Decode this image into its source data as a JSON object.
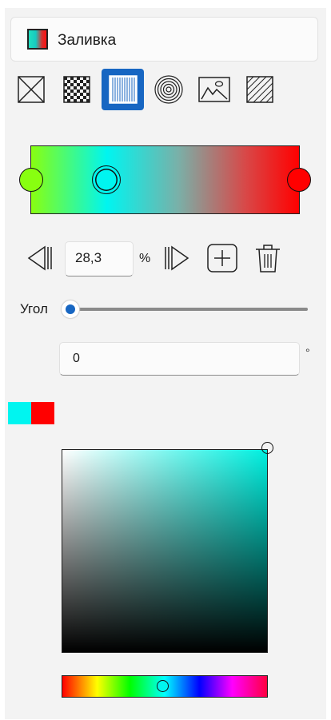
{
  "fill": {
    "title": "Заливка",
    "types": [
      {
        "icon": "no-fill-icon",
        "selected": false
      },
      {
        "icon": "pattern-fill-icon",
        "selected": false
      },
      {
        "icon": "linear-gradient-fill-icon",
        "selected": true
      },
      {
        "icon": "radial-gradient-fill-icon",
        "selected": false
      },
      {
        "icon": "image-fill-icon",
        "selected": false
      },
      {
        "icon": "hatch-fill-icon",
        "selected": false
      }
    ]
  },
  "gradient": {
    "stops": [
      {
        "position": 0,
        "color": "#88ff10"
      },
      {
        "position": 28.3,
        "color": "#00f5f0",
        "selected": true
      },
      {
        "position": 100,
        "color": "#ff0000"
      }
    ],
    "stop_position_value": "28,3",
    "stop_position_unit": "%"
  },
  "angle": {
    "label": "Угол",
    "value": "0",
    "unit": "°",
    "slider_fraction": 0
  },
  "recent_colors": [
    "#00f5f0",
    "#ff0000"
  ],
  "picker": {
    "hue_color": "#00f0e0",
    "selected_color": "#00f5f0"
  }
}
